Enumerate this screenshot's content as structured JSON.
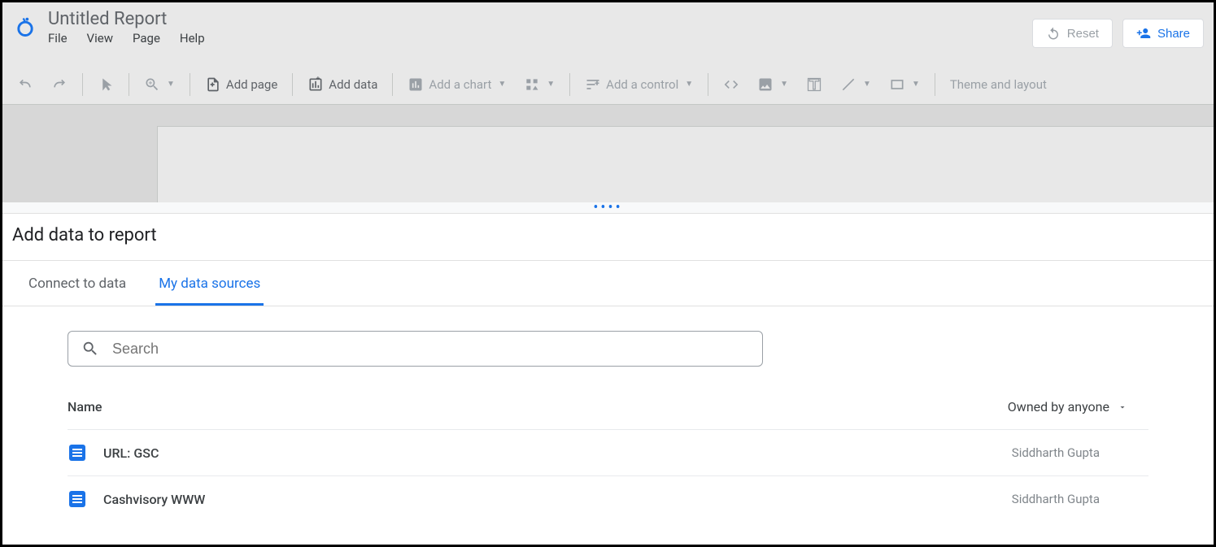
{
  "header": {
    "title": "Untitled Report",
    "menu": {
      "file": "File",
      "view": "View",
      "page": "Page",
      "help": "Help"
    },
    "reset": "Reset",
    "share": "Share"
  },
  "toolbar": {
    "add_page": "Add page",
    "add_data": "Add data",
    "add_chart": "Add a chart",
    "add_control": "Add a control",
    "theme_layout": "Theme and layout"
  },
  "panel": {
    "title": "Add data to report",
    "tabs": {
      "connect": "Connect to data",
      "sources": "My data sources"
    },
    "search_placeholder": "Search",
    "columns": {
      "name": "Name",
      "owner": "Owned by anyone"
    },
    "rows": [
      {
        "name": "URL: GSC",
        "owner": "Siddharth Gupta"
      },
      {
        "name": "Cashvisory WWW",
        "owner": "Siddharth Gupta"
      }
    ]
  }
}
